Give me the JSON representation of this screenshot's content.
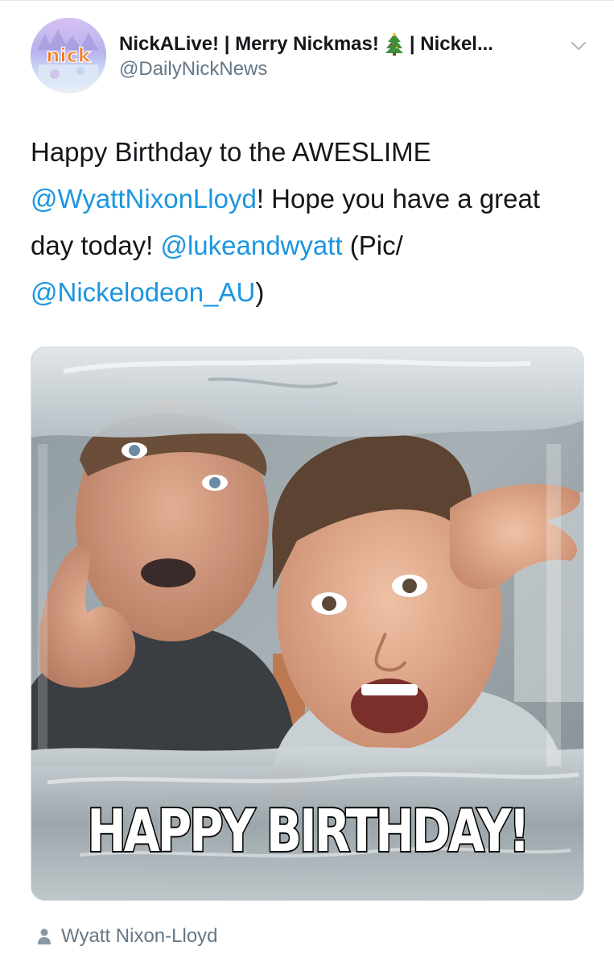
{
  "tweet": {
    "author": {
      "name_part1": "NickALive! | Merry Nickmas!",
      "name_part2": "| Nickel...",
      "name_emoji_icon": "christmas-tree-icon",
      "handle": "@DailyNickNews",
      "avatar_text": "nick"
    },
    "menu_icon": "chevron-down-icon",
    "text": {
      "t1": "Happy Birthday to the AWESLIME ",
      "m1": "@WyattNixonLloyd",
      "t2": "! Hope you have a great day today! ",
      "m2": "@lukeandwyatt",
      "t3": " (Pic/ ",
      "m3": "@Nickelodeon_AU",
      "t4": ")"
    },
    "media": {
      "caption": "HAPPY BIRTHDAY!"
    },
    "tagged": {
      "icon": "person-icon",
      "name": "Wyatt Nixon-Lloyd"
    }
  },
  "colors": {
    "text": "#14171a",
    "secondary": "#657786",
    "link": "#1b95e0",
    "border": "#e1e8ed"
  }
}
